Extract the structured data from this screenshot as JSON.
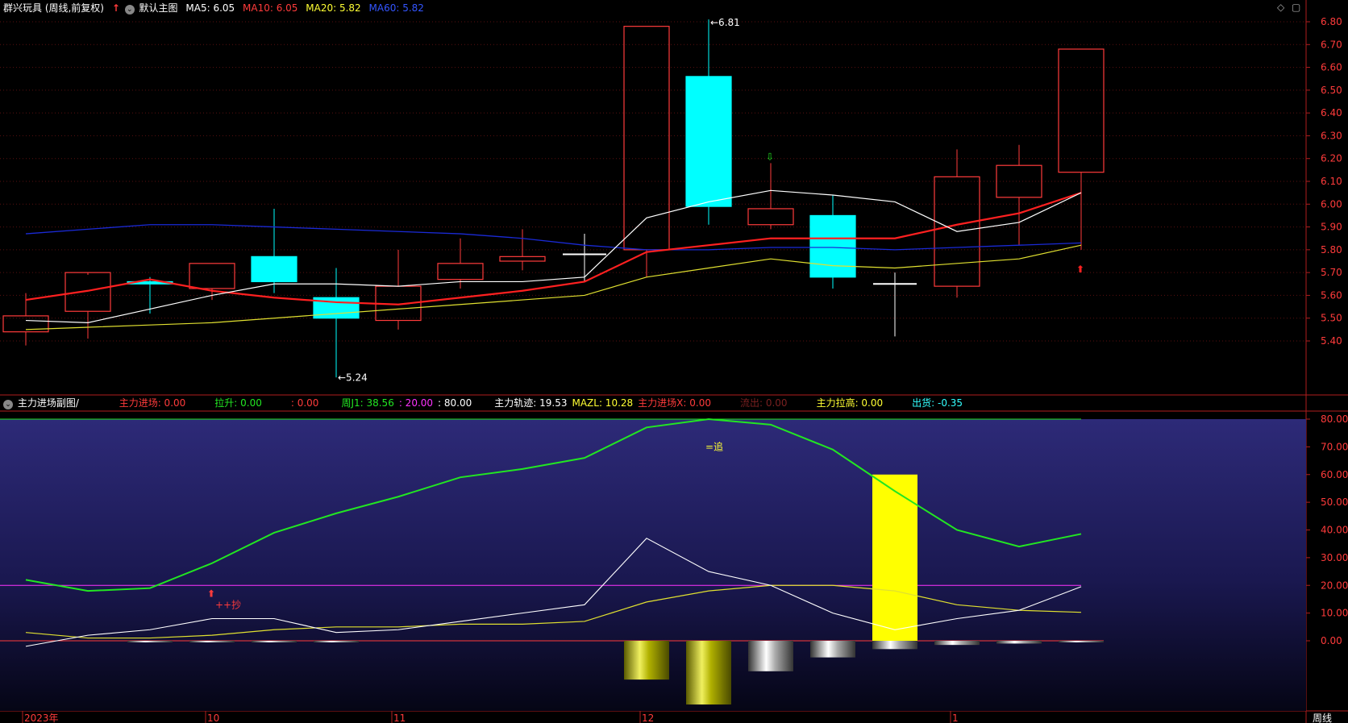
{
  "main_header": {
    "title": "群兴玩具 (周线,前复权)",
    "indicator": "默认主图",
    "ma5": "MA5: 6.05",
    "ma10": "MA10: 6.05",
    "ma20": "MA20: 5.82",
    "ma60": "MA60: 5.82"
  },
  "sub_header": {
    "title": "主力进场副图/",
    "items": [
      {
        "text": "主力进场: 0.00",
        "color": "#ff3b3b"
      },
      {
        "text": "拉升: 0.00",
        "color": "#22e622"
      },
      {
        "text": ": 0.00",
        "color": "#ff3b3b"
      },
      {
        "text": "周J1: 38.56",
        "color": "#22e622"
      },
      {
        "text": ": 20.00",
        "color": "#ff33ff"
      },
      {
        "text": ": 80.00",
        "color": "#ffffff"
      },
      {
        "text": "主力轨迹: 19.53",
        "color": "#ffffff"
      },
      {
        "text": "MAZL: 10.28",
        "color": "#ffff33"
      },
      {
        "text": "主力进场X: 0.00",
        "color": "#ff3b3b"
      },
      {
        "text": "流出: 0.00",
        "color": "#7a2020"
      },
      {
        "text": "主力拉高: 0.00",
        "color": "#ffff33"
      },
      {
        "text": "出货: -0.35",
        "color": "#33ffff"
      }
    ]
  },
  "main_axis_ticks": [
    "6.80",
    "6.70",
    "6.60",
    "6.50",
    "6.40",
    "6.30",
    "6.20",
    "6.10",
    "6.00",
    "5.90",
    "5.80",
    "5.70",
    "5.60",
    "5.50",
    "5.40"
  ],
  "sub_axis_ticks": [
    "80.00",
    "70.00",
    "60.00",
    "50.00",
    "40.00",
    "30.00",
    "20.00",
    "10.00",
    "0.00"
  ],
  "time_labels": [
    {
      "text": "2023年",
      "index": 0
    },
    {
      "text": "10",
      "index": 3
    },
    {
      "text": "11",
      "index": 6
    },
    {
      "text": "12",
      "index": 10
    },
    {
      "text": "1",
      "index": 15
    }
  ],
  "period_label": "周线",
  "annotations": {
    "high_label": "6.81",
    "low_label": "5.24",
    "chase_label": "=追",
    "buy_label": "++抄"
  },
  "chart_data": {
    "type": "candlestick",
    "price_range": [
      5.2,
      6.88
    ],
    "candles": [
      {
        "o": 5.44,
        "h": 5.61,
        "l": 5.38,
        "c": 5.51
      },
      {
        "o": 5.53,
        "h": 5.69,
        "l": 5.41,
        "c": 5.7
      },
      {
        "o": 5.66,
        "h": 5.68,
        "l": 5.52,
        "c": 5.65
      },
      {
        "o": 5.63,
        "h": 5.74,
        "l": 5.58,
        "c": 5.74
      },
      {
        "o": 5.77,
        "h": 5.98,
        "l": 5.61,
        "c": 5.66
      },
      {
        "o": 5.59,
        "h": 5.72,
        "l": 5.24,
        "c": 5.5
      },
      {
        "o": 5.49,
        "h": 5.8,
        "l": 5.45,
        "c": 5.64
      },
      {
        "o": 5.67,
        "h": 5.85,
        "l": 5.63,
        "c": 5.74
      },
      {
        "o": 5.75,
        "h": 5.89,
        "l": 5.71,
        "c": 5.77
      },
      {
        "o": 5.78,
        "h": 5.87,
        "l": 5.66,
        "c": 5.78
      },
      {
        "o": 5.8,
        "h": 6.78,
        "l": 5.68,
        "c": 6.78
      },
      {
        "o": 6.56,
        "h": 6.81,
        "l": 5.91,
        "c": 5.99
      },
      {
        "o": 5.91,
        "h": 6.18,
        "l": 5.89,
        "c": 5.98
      },
      {
        "o": 5.95,
        "h": 6.04,
        "l": 5.63,
        "c": 5.68
      },
      {
        "o": 5.65,
        "h": 5.7,
        "l": 5.42,
        "c": 5.65
      },
      {
        "o": 5.64,
        "h": 6.24,
        "l": 5.59,
        "c": 6.12
      },
      {
        "o": 6.03,
        "h": 6.26,
        "l": 5.82,
        "c": 6.17
      },
      {
        "o": 6.14,
        "h": 6.68,
        "l": 5.8,
        "c": 6.68
      }
    ],
    "ma5": [
      5.49,
      5.48,
      5.54,
      5.6,
      5.65,
      5.65,
      5.64,
      5.66,
      5.66,
      5.68,
      5.94,
      6.01,
      6.06,
      6.04,
      6.01,
      5.88,
      5.92,
      6.05
    ],
    "ma10": [
      5.58,
      5.62,
      5.67,
      5.62,
      5.59,
      5.57,
      5.56,
      5.59,
      5.62,
      5.66,
      5.79,
      5.82,
      5.85,
      5.85,
      5.85,
      5.91,
      5.96,
      6.05
    ],
    "ma20": [
      5.45,
      5.46,
      5.47,
      5.48,
      5.5,
      5.52,
      5.54,
      5.56,
      5.58,
      5.6,
      5.68,
      5.72,
      5.76,
      5.73,
      5.72,
      5.74,
      5.76,
      5.82
    ],
    "ma60": [
      5.87,
      5.89,
      5.91,
      5.91,
      5.9,
      5.89,
      5.88,
      5.87,
      5.85,
      5.82,
      5.8,
      5.8,
      5.81,
      5.81,
      5.8,
      5.81,
      5.82,
      5.83
    ],
    "sub": {
      "range": [
        -23,
        80
      ],
      "j1": [
        22,
        18,
        19,
        28,
        39,
        46,
        52,
        59,
        62,
        66,
        77,
        80,
        78,
        69,
        54,
        40,
        34,
        38.56
      ],
      "trail": [
        -2,
        2,
        4,
        8,
        8,
        3,
        4,
        7,
        10,
        13,
        37,
        25,
        20,
        10,
        4,
        8,
        11,
        19.53
      ],
      "mazl": [
        3,
        1,
        1,
        2,
        4,
        5,
        5,
        6,
        6,
        7,
        14,
        18,
        20,
        20,
        18,
        13,
        11,
        10.28
      ],
      "line20": 20,
      "line80": 80,
      "yellow_bar": {
        "index": 14,
        "value": 60
      },
      "neg_bars": [
        {
          "index": 2,
          "value": -0.2
        },
        {
          "index": 3,
          "value": -0.3
        },
        {
          "index": 4,
          "value": -0.3
        },
        {
          "index": 5,
          "value": -0.3
        },
        {
          "index": 10,
          "value": -14
        },
        {
          "index": 11,
          "value": -23
        },
        {
          "index": 12,
          "value": -11
        },
        {
          "index": 13,
          "value": -6
        },
        {
          "index": 14,
          "value": -3
        },
        {
          "index": 15,
          "value": -1.5
        },
        {
          "index": 16,
          "value": -1
        },
        {
          "index": 17,
          "value": -0.35
        }
      ]
    }
  }
}
